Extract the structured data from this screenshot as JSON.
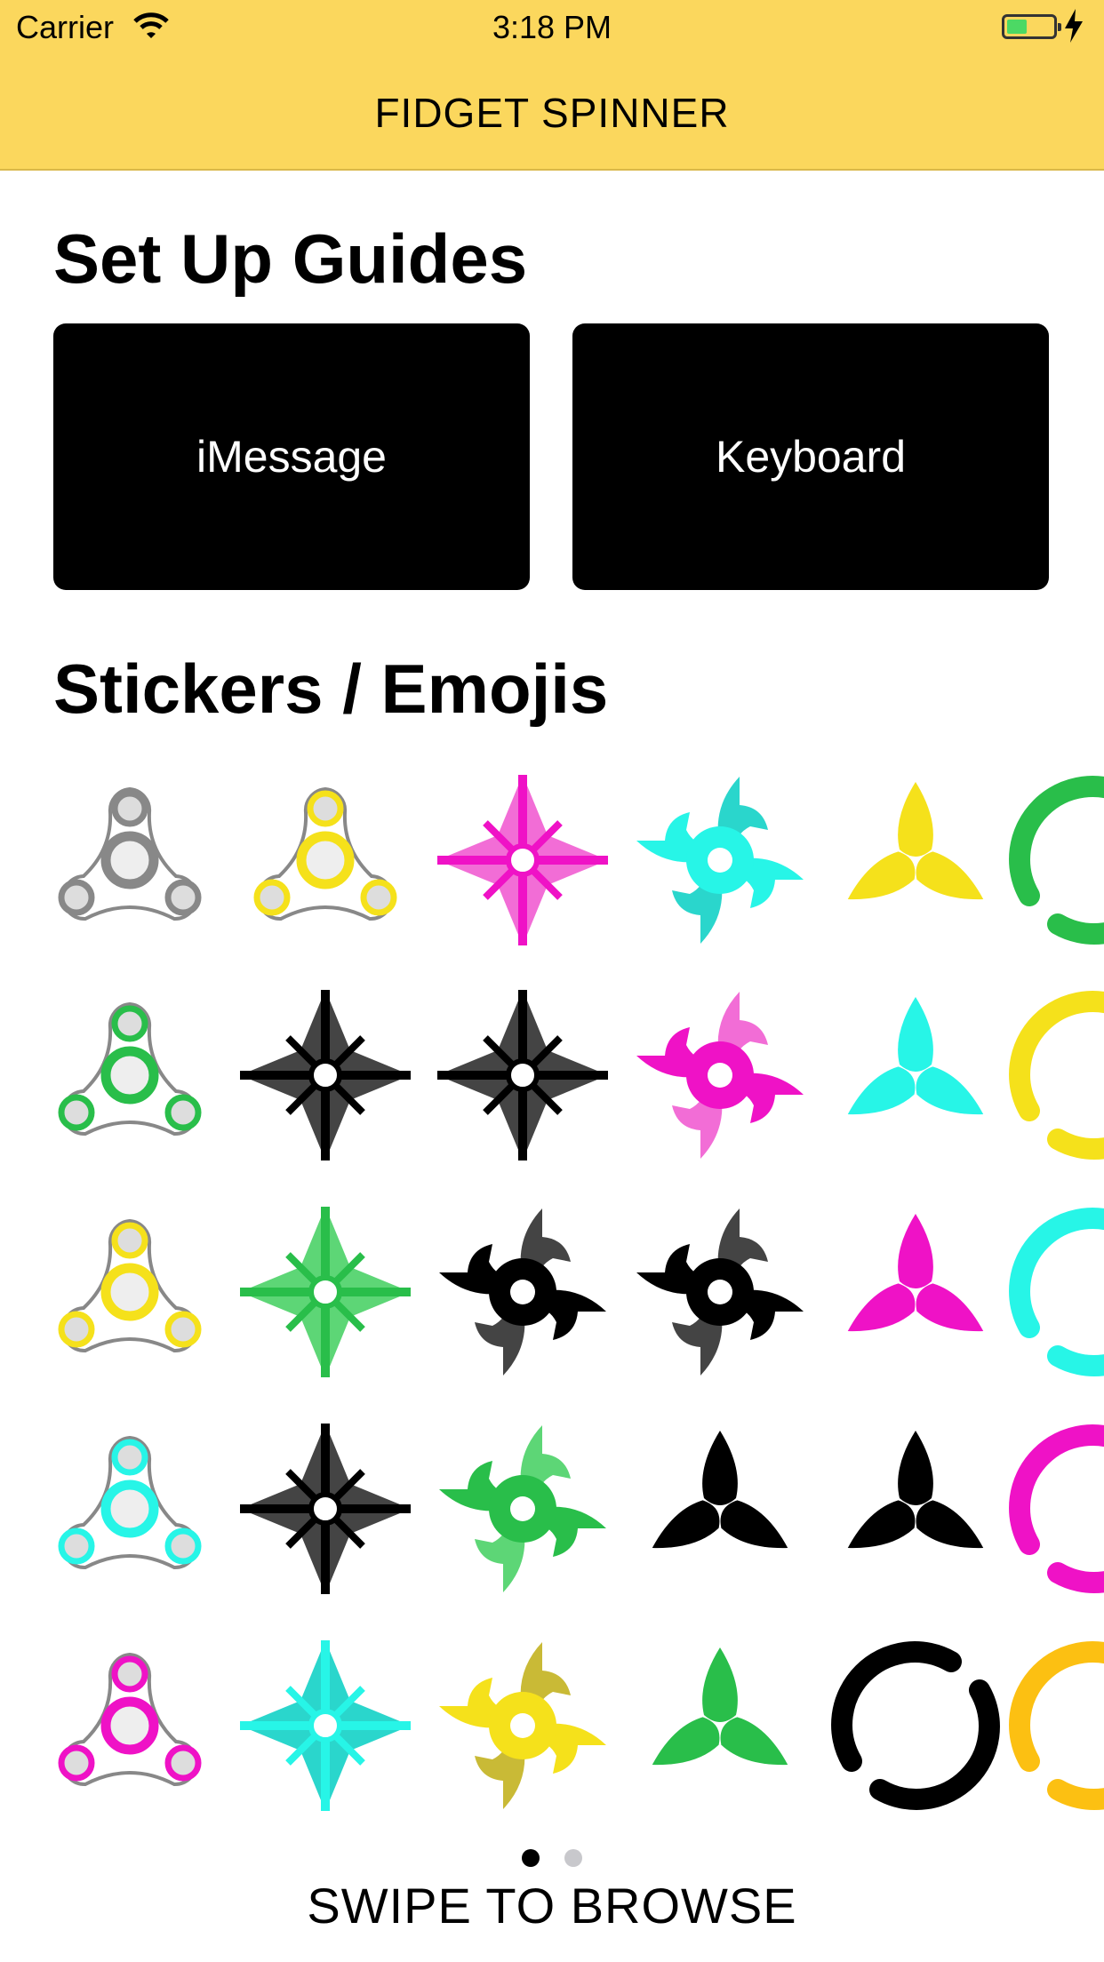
{
  "status_bar": {
    "carrier": "Carrier",
    "time": "3:18 PM"
  },
  "header": {
    "title": "FIDGET SPINNER",
    "background": "#fbd75d"
  },
  "setup": {
    "heading": "Set Up Guides",
    "imessage_label": "iMessage",
    "keyboard_label": "Keyboard"
  },
  "stickers": {
    "heading": "Stickers / Emojis",
    "rows": [
      [
        "fidget-spinner-gray",
        "fidget-spinner-yellow-black",
        "shuriken-magenta",
        "pinwheel-cyan",
        "tri-blade-yellow",
        "ring-green"
      ],
      [
        "fidget-spinner-green",
        "shuriken-black-gray",
        "shuriken-black-yellow",
        "pinwheel-magenta",
        "tri-blade-cyan",
        "ring-yellow"
      ],
      [
        "fidget-spinner-yellow",
        "shuriken-green",
        "pinwheel-black-gray",
        "pinwheel-black-yellow",
        "tri-blade-magenta",
        "ring-cyan"
      ],
      [
        "fidget-spinner-cyan",
        "shuriken-olive-yellow",
        "pinwheel-green",
        "tri-blade-black",
        "tri-blade-black-yellow",
        "ring-magenta"
      ],
      [
        "fidget-spinner-magenta",
        "shuriken-cyan",
        "pinwheel-yellow",
        "tri-blade-green",
        "ring-black",
        "ring-orange"
      ]
    ]
  },
  "pager": {
    "page": 1,
    "pages": 2,
    "label": "SWIPE TO BROWSE"
  }
}
